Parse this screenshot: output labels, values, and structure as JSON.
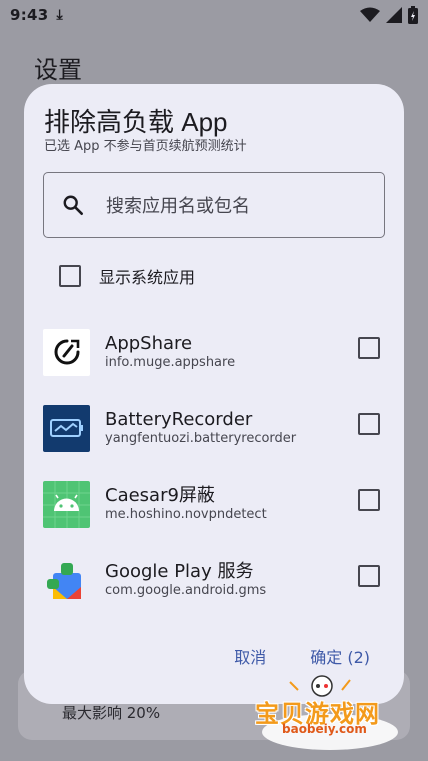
{
  "status_bar": {
    "time": "9:43",
    "download_glyph": "⤓"
  },
  "background": {
    "title": "设置",
    "card_text": "最大影响 20%"
  },
  "dialog": {
    "title": "排除高负载 App",
    "subtitle": "已选 App 不参与首页续航预测统计",
    "search_placeholder": "搜索应用名或包名",
    "show_system_label": "显示系统应用",
    "show_system_checked": false,
    "apps": [
      {
        "name": "AppShare",
        "package": "info.muge.appshare",
        "icon": "appshare-icon",
        "checked": false
      },
      {
        "name": "BatteryRecorder",
        "package": "yangfentuozi.batteryrecorder",
        "icon": "battery-recorder-icon",
        "checked": false
      },
      {
        "name": "Caesar9屏蔽",
        "package": "me.hoshino.novpndetect",
        "icon": "android-robot-icon",
        "checked": false
      },
      {
        "name": "Google Play 服务",
        "package": "com.google.android.gms",
        "icon": "google-play-services-icon",
        "checked": false
      }
    ],
    "cancel_label": "取消",
    "confirm_label": "确定 (2)"
  },
  "watermark": {
    "text": "宝贝游戏网",
    "url": "baobeiy.com"
  },
  "colors": {
    "dialog_bg": "#ececf6",
    "accent": "#3f5aa8",
    "scrim": "#9b9ba3"
  }
}
